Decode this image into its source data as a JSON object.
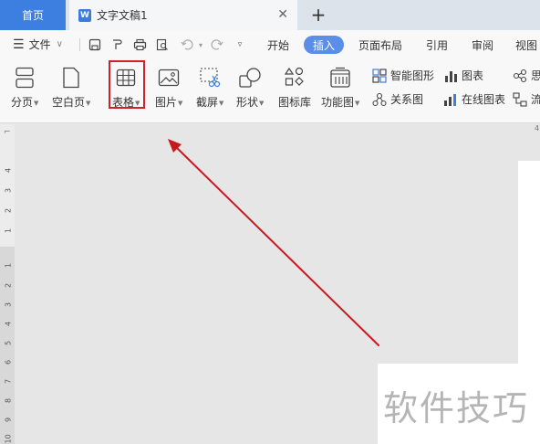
{
  "tabs": {
    "home_label": "首页",
    "doc_icon_letter": "W",
    "doc_title": "文字文稿1",
    "close_glyph": "✕",
    "add_glyph": "+"
  },
  "menu": {
    "file_label": "文件",
    "items": [
      "开始",
      "插入",
      "页面布局",
      "引用",
      "审阅",
      "视图"
    ],
    "active_item": "插入"
  },
  "ribbon": {
    "page_break_label": "分页",
    "blank_page_label": "空白页",
    "table_label": "表格",
    "picture_label": "图片",
    "screenshot_label": "截屏",
    "shape_label": "形状",
    "icon_lib_label": "图标库",
    "function_chart_label": "功能图",
    "smart_graphic_label": "智能图形",
    "chart_label": "图表",
    "relation_label": "关系图",
    "online_chart_label": "在线图表",
    "mind_label": "思",
    "flow_label": "流"
  },
  "ruler": {
    "corner": "⌐",
    "upper_numbers": [
      "4",
      "3",
      "2",
      "1"
    ],
    "lower_numbers": [
      "1",
      "2",
      "3",
      "4",
      "5",
      "6",
      "7",
      "8",
      "9",
      "10"
    ]
  },
  "watermark_text": "软件技巧",
  "colors": {
    "accent": "#3d7fe0",
    "active_tab": "#5a8ee8",
    "highlight": "#d0202a",
    "arrow": "#c8181f"
  }
}
